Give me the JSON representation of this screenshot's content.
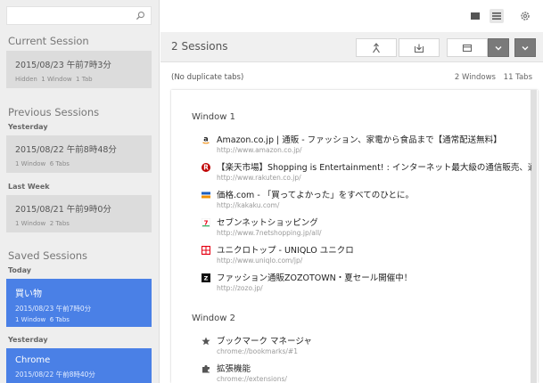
{
  "colors": {
    "accent": "#4a80e6",
    "sidebar_bg": "#eeeeee",
    "header_bg": "#f0f0f0"
  },
  "sidebar": {
    "search_placeholder": "",
    "current": {
      "title": "Current Session",
      "card": {
        "date": "2015/08/23 午前7時3分",
        "meta": [
          "Hidden",
          "1 Window",
          "1 Tab"
        ]
      }
    },
    "previous": {
      "title": "Previous Sessions",
      "groups": [
        {
          "label": "Yesterday",
          "date": "2015/08/22 午前8時48分",
          "meta": [
            "1 Window",
            "6 Tabs"
          ]
        },
        {
          "label": "Last Week",
          "date": "2015/08/21 午前9時0分",
          "meta": [
            "1 Window",
            "2 Tabs"
          ]
        }
      ]
    },
    "saved": {
      "title": "Saved Sessions",
      "groups": [
        {
          "label": "Today",
          "name": "買い物",
          "date": "2015/08/23 午前7時0分",
          "meta": [
            "1 Window",
            "6 Tabs"
          ]
        },
        {
          "label": "Yesterday",
          "name": "Chrome",
          "date": "2015/08/22 午前8時40分",
          "meta": []
        }
      ]
    }
  },
  "topbar": {
    "icons": [
      "window-view-icon",
      "list-view-icon",
      "settings-icon"
    ]
  },
  "header": {
    "title": "2 Sessions",
    "buttons": [
      "merge-icon",
      "save-icon",
      "window-icon",
      "dropdown-icon",
      "dropdown-icon"
    ]
  },
  "info": {
    "duplicates": "(No duplicate tabs)",
    "windows": "2 Windows",
    "tabs": "11 Tabs"
  },
  "windows": [
    {
      "title": "Window 1",
      "tabs": [
        {
          "title": "Amazon.co.jp | 通販 - ファッション、家電から食品まで【通常配送無料】",
          "url": "http://www.amazon.co.jp/",
          "icon": "amazon-icon"
        },
        {
          "title": "【楽天市場】Shopping is Entertainment! : インターネット最大級の通信販売、通販オンラ",
          "url": "http://www.rakuten.co.jp/",
          "icon": "rakuten-icon"
        },
        {
          "title": "価格.com - 「買ってよかった」をすべてのひとに。",
          "url": "http://kakaku.com/",
          "icon": "kakaku-icon"
        },
        {
          "title": "セブンネットショッピング",
          "url": "http://www.7netshopping.jp/all/",
          "icon": "seven-net-icon"
        },
        {
          "title": "ユニクロトップ - UNIQLO ユニクロ",
          "url": "http://www.uniqlo.com/jp/",
          "icon": "uniqlo-icon"
        },
        {
          "title": "ファッション通販ZOZOTOWN・夏セール開催中！",
          "url": "http://zozo.jp/",
          "icon": "zozo-icon"
        }
      ]
    },
    {
      "title": "Window 2",
      "tabs": [
        {
          "title": "ブックマーク マネージャ",
          "url": "chrome://bookmarks/#1",
          "icon": "star-icon"
        },
        {
          "title": "拡張機能",
          "url": "chrome://extensions/",
          "icon": "puzzle-icon"
        }
      ]
    }
  ]
}
